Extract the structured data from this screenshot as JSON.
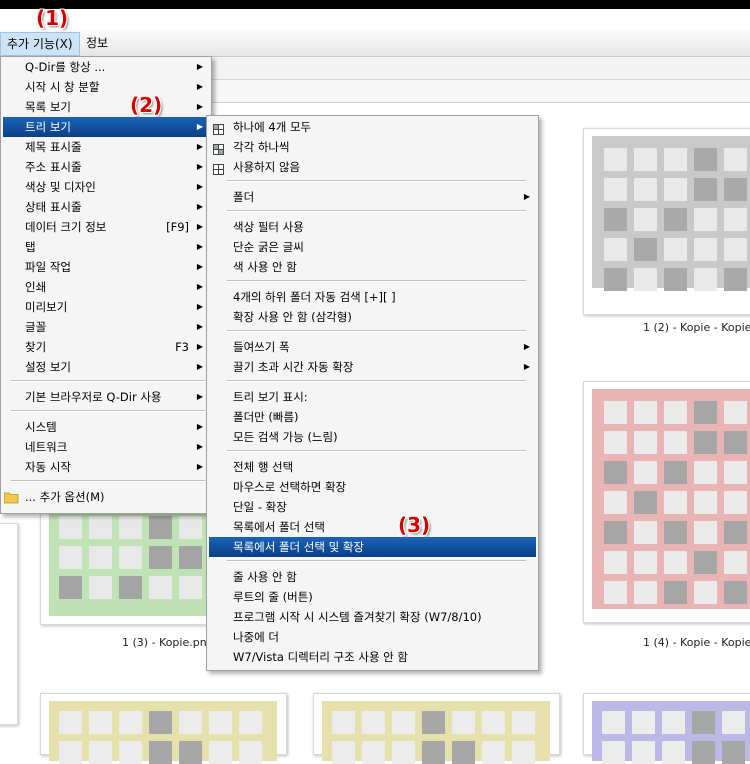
{
  "menubar": {
    "items": [
      {
        "label": "추가 기능(X)",
        "active": true
      },
      {
        "label": "정보",
        "active": false
      }
    ]
  },
  "annotations": [
    "(1)",
    "(2)",
    "(3)"
  ],
  "main_menu": {
    "items": [
      {
        "label": "Q-Dir를 항상 ...",
        "arrow": true
      },
      {
        "label": "시작 시 창 분할",
        "arrow": true
      },
      {
        "label": "목록 보기",
        "arrow": true
      },
      {
        "label": "트리 보기",
        "arrow": true,
        "highlighted": true
      },
      {
        "label": "제목 표시줄",
        "arrow": true
      },
      {
        "label": "주소 표시줄",
        "arrow": true
      },
      {
        "label": "색상 및 디자인",
        "arrow": true
      },
      {
        "label": "상태 표시줄",
        "arrow": true
      },
      {
        "label": "데이터 크기 정보",
        "shortcut": "[F9]",
        "arrow": true
      },
      {
        "label": "탭",
        "arrow": true
      },
      {
        "label": "파일 작업",
        "arrow": true
      },
      {
        "label": "인쇄",
        "arrow": true
      },
      {
        "label": "미리보기",
        "arrow": true
      },
      {
        "label": "글꼴",
        "arrow": true
      },
      {
        "label": "찾기",
        "shortcut": "F3",
        "arrow": true
      },
      {
        "label": "설정 보기",
        "arrow": true
      },
      {
        "label": "기본 브라우저로 Q-Dir 사용",
        "arrow": true
      },
      {
        "label": "시스템",
        "arrow": true
      },
      {
        "label": "네트워크",
        "arrow": true
      },
      {
        "label": "자동 시작",
        "arrow": true
      },
      {
        "label": "... 추가 옵션(M)",
        "icon": "folder-icon"
      }
    ]
  },
  "sub_menu": {
    "items": [
      {
        "label": "하나에 4개 모두",
        "icon": "grid-four-icon"
      },
      {
        "label": "각각 하나씩",
        "icon": "grid-each-icon"
      },
      {
        "label": "사용하지 않음",
        "icon": "grid-none-icon"
      },
      {
        "label": "폴더",
        "arrow": true
      },
      {
        "label": "색상 필터 사용"
      },
      {
        "label": "단순 굵은 글씨"
      },
      {
        "label": "색 사용 안 함"
      },
      {
        "label": "4개의 하위 폴더 자동 검색 [+][ ]"
      },
      {
        "label": "확장 사용 안 함 (삼각형)"
      },
      {
        "label": "들여쓰기 폭",
        "arrow": true
      },
      {
        "label": "끌기 초과 시간 자동 확장",
        "arrow": true
      },
      {
        "label": "트리 보기 표시:"
      },
      {
        "label": "폴더만 (빠름)"
      },
      {
        "label": "모든 검색 가능 (느림)"
      },
      {
        "label": "전체 행 선택"
      },
      {
        "label": "마우스로 선택하면 확장"
      },
      {
        "label": "단일 - 확장"
      },
      {
        "label": "목록에서 폴더 선택"
      },
      {
        "label": "목록에서 폴더 선택 및 확장",
        "highlighted": true
      },
      {
        "label": "줄 사용 안 함"
      },
      {
        "label": "루트의 줄 (버튼)"
      },
      {
        "label": "프로그램 시작 시 시스템 즐겨찾기 확장 (W7/8/10)"
      },
      {
        "label": "나중에 더"
      },
      {
        "label": "W7/Vista 디렉터리 구조 사용 안 함"
      }
    ]
  },
  "thumbnails": [
    {
      "caption": "1 (2) - Kopie - Kopie.",
      "color": "#c9c9c9",
      "dark": "#a9a9a9",
      "light": "#e9e9e9"
    },
    {
      "caption": "1 (3) - Kopie.png",
      "color": "#bfe3b4",
      "dark": "#a4a4a4",
      "light": "#e8e8e8"
    },
    {
      "caption": "1 (4) - Kopie - Kopie.",
      "color": "#e8b4b4",
      "dark": "#a6a6a6",
      "light": "#ebebeb"
    },
    {
      "caption": "",
      "color": "#e6e0ad",
      "dark": "#a7a7a7",
      "light": "#ececec"
    },
    {
      "caption": "",
      "color": "#e6e0ad",
      "dark": "#a7a7a7",
      "light": "#ececec"
    },
    {
      "caption": "",
      "color": "#bcb9e6",
      "dark": "#a7a7a7",
      "light": "#ececec"
    }
  ],
  "colors": {
    "highlight": "#0b4a95",
    "marker": "#d40000",
    "menu_bg": "#f5f5f5"
  }
}
